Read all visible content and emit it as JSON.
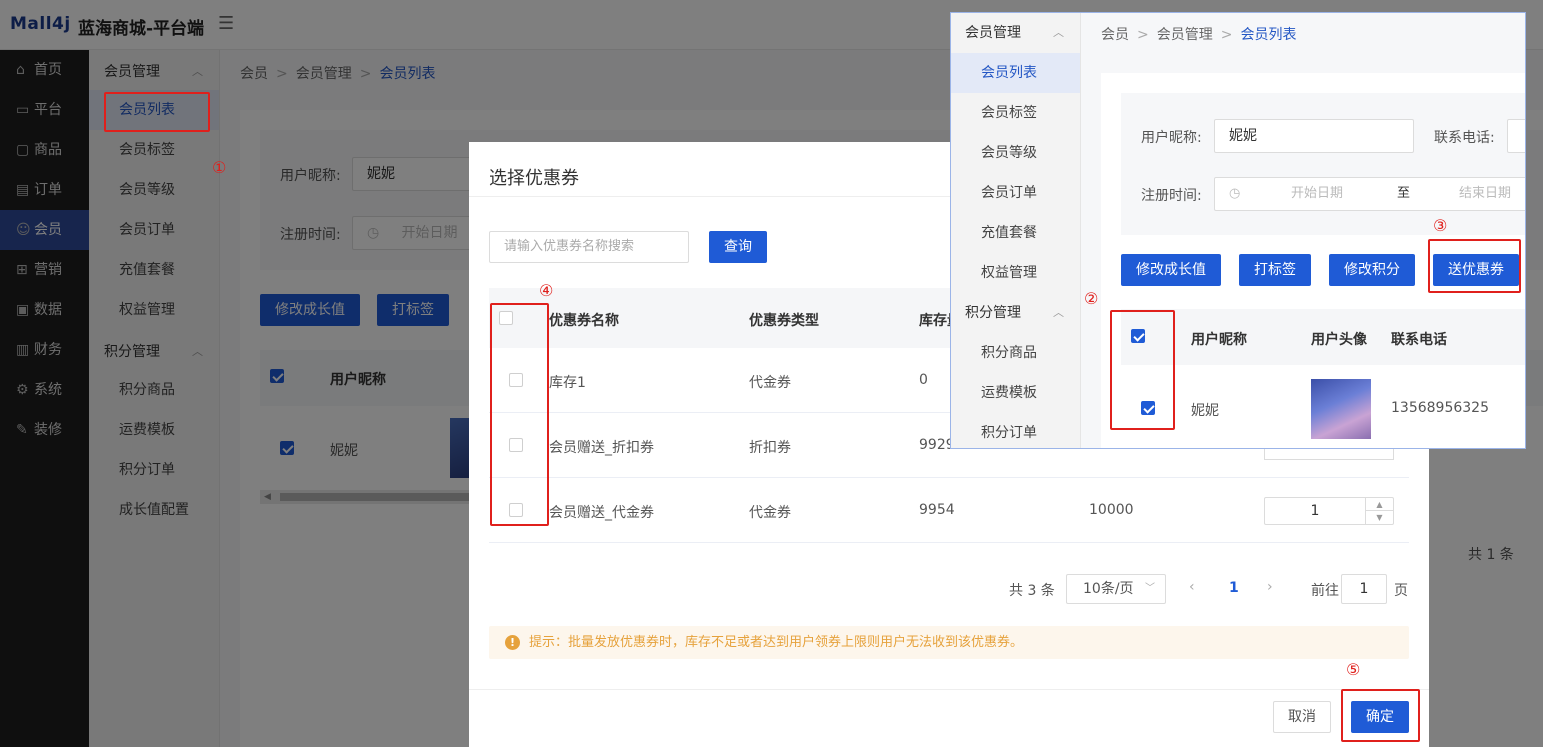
{
  "header": {
    "logo": "Mall4j",
    "app_name": "蓝海商城-平台端",
    "menu_icon": "hamburger-icon"
  },
  "main_nav": [
    {
      "label": "首页",
      "icon": "home-icon",
      "glyph": "⌂"
    },
    {
      "label": "平台",
      "icon": "monitor-icon",
      "glyph": "▭"
    },
    {
      "label": "商品",
      "icon": "product-icon",
      "glyph": "▢"
    },
    {
      "label": "订单",
      "icon": "order-icon",
      "glyph": "▤"
    },
    {
      "label": "会员",
      "icon": "member-icon",
      "glyph": "☺"
    },
    {
      "label": "营销",
      "icon": "gift-icon",
      "glyph": "⊞"
    },
    {
      "label": "数据",
      "icon": "data-icon",
      "glyph": "▣"
    },
    {
      "label": "财务",
      "icon": "finance-icon",
      "glyph": "▥"
    },
    {
      "label": "系统",
      "icon": "gear-icon",
      "glyph": "⚙"
    },
    {
      "label": "装修",
      "icon": "decorate-icon",
      "glyph": "✎"
    }
  ],
  "sub_nav": {
    "group1": "会员管理",
    "group1_items": [
      "会员列表",
      "会员标签",
      "会员等级",
      "会员订单",
      "充值套餐",
      "权益管理"
    ],
    "group2": "积分管理",
    "group2_items": [
      "积分商品",
      "运费模板",
      "积分订单",
      "成长值配置"
    ]
  },
  "breadcrumb": [
    "会员",
    "会员管理",
    "会员列表"
  ],
  "filters": {
    "nickname_label": "用户昵称:",
    "nickname_value": "妮妮",
    "phone_label": "联系电话:",
    "reg_time_label": "注册时间:",
    "start_date": "开始日期",
    "date_to": "至",
    "end_date": "结束日期"
  },
  "actions": [
    "修改成长值",
    "打标签",
    "修改积分",
    "送优惠券"
  ],
  "user_table": {
    "headers": [
      "用户昵称",
      "用户头像",
      "联系电话"
    ],
    "row": {
      "nickname": "妮妮",
      "phone": "13568956325"
    }
  },
  "bg_pagination": {
    "total": "共 1 条"
  },
  "dialog": {
    "title": "选择优惠券",
    "search_placeholder": "请输入优惠券名称搜索",
    "query_button": "查询",
    "headers": [
      "优惠券名称",
      "优惠券类型",
      "库存量"
    ],
    "rows": [
      {
        "name": "库存1",
        "type": "代金券",
        "stock": "0",
        "total": "",
        "qty": ""
      },
      {
        "name": "会员赠送_折扣券",
        "type": "折扣券",
        "stock": "9929",
        "total": "",
        "qty": ""
      },
      {
        "name": "会员赠送_代金券",
        "type": "代金券",
        "stock": "9954",
        "total": "10000",
        "qty": "1"
      }
    ],
    "pagination": {
      "total": "共 3 条",
      "page_size": "10条/页",
      "current": "1",
      "goto_label": "前往",
      "goto_value": "1",
      "page_suffix": "页"
    },
    "tip": "提示：批量发放优惠券时，库存不足或者达到用户领券上限则用户无法收到该优惠券。",
    "cancel": "取消",
    "confirm": "确定"
  },
  "annotations": [
    "①",
    "②",
    "③",
    "④",
    "⑤"
  ],
  "colors": {
    "primary": "#1f5bd6",
    "annotation": "#e0201c",
    "nav_bg": "#1e1e1e",
    "tip": "#e6a23c"
  }
}
